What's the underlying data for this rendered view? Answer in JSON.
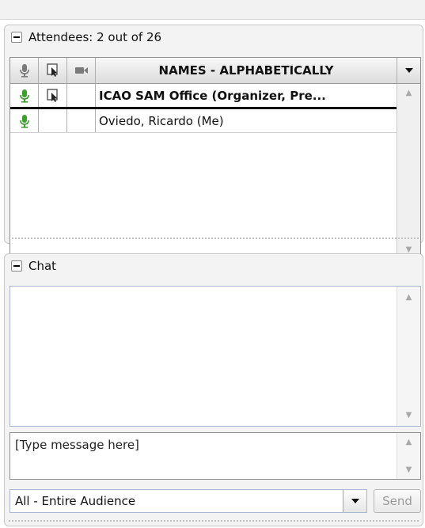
{
  "attendees": {
    "title": "Attendees:  2 out of 26",
    "sort_header": "NAMES - ALPHABETICALLY",
    "rows": [
      {
        "name": "ICAO SAM Office (Organizer, Pre...",
        "mic": "mic-icon",
        "present": "presenter-icon"
      },
      {
        "name": "Oviedo, Ricardo (Me)",
        "mic": "mic-icon"
      }
    ]
  },
  "chat": {
    "title": "Chat",
    "input_placeholder": "[Type message here]",
    "audience": "All - Entire Audience",
    "send_label": "Send"
  },
  "colors": {
    "mic_active": "#3da02e",
    "panel_bg": "#f3f3f3"
  }
}
